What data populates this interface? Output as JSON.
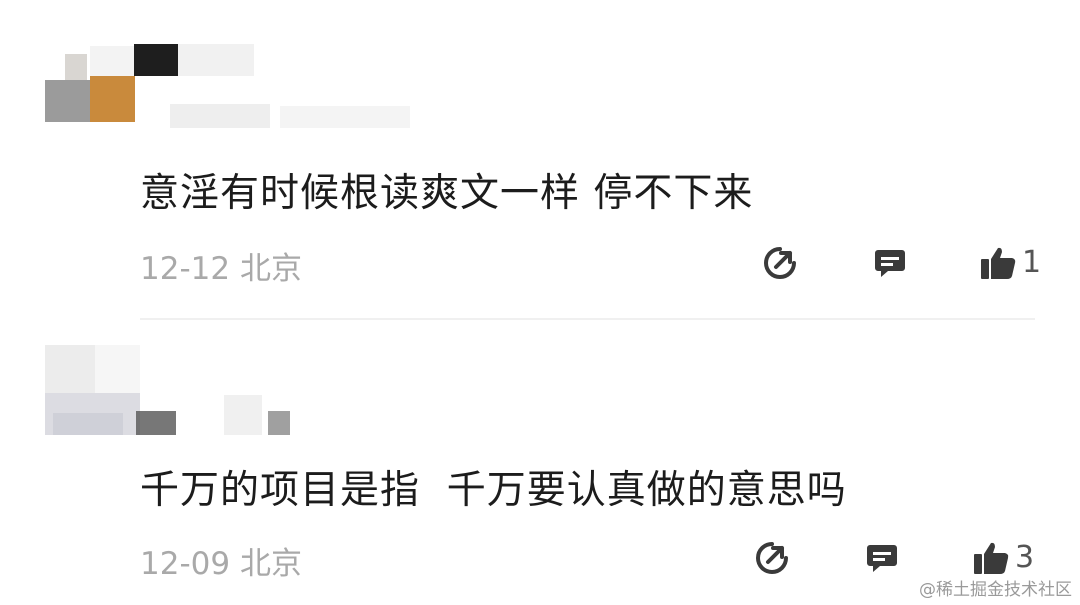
{
  "comments": [
    {
      "text": "意淫有时候根读爽文一样 停不下来",
      "date": "12-12",
      "location": "北京",
      "likes": "1"
    },
    {
      "text": "千万的项目是指  千万要认真做的意思吗",
      "date": "12-09",
      "location": "北京",
      "likes": "3"
    }
  ],
  "icons": {
    "share": "share-icon",
    "reply": "comment-bubble-icon",
    "like": "thumbs-up-icon"
  },
  "colors": {
    "icon": "#3a3a3a",
    "meta": "#a9a9a9"
  },
  "watermark": "@稀土掘金技术社区"
}
